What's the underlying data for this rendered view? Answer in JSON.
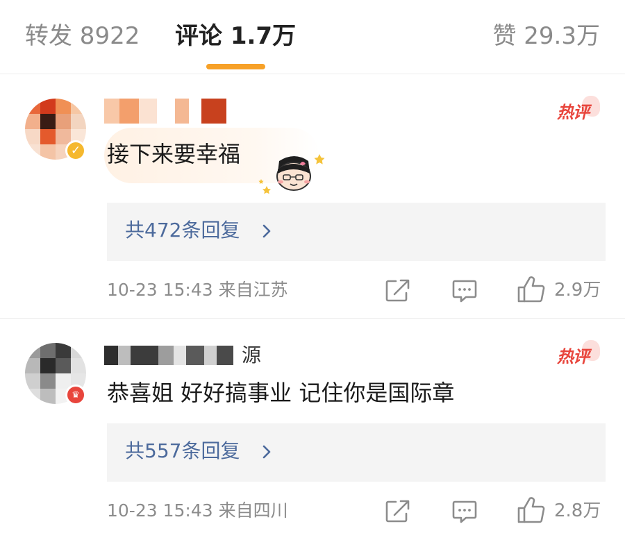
{
  "tabs": {
    "forward": "转发 8922",
    "comments": "评论 1.7万",
    "likes": "赞 29.3万"
  },
  "colors": {
    "accent": "#f7a128",
    "link": "#4c6a9c",
    "hot": "#e8453c",
    "muted": "#8c8c8c"
  },
  "comments": [
    {
      "text": "接下来要幸福",
      "hot_label": "热评",
      "replies_label": "共472条回复",
      "meta": "10-23 15:43 来自江苏",
      "likes": "2.9万",
      "badge": "verified-v-badge"
    },
    {
      "username_partial": "源",
      "text": "恭喜姐 好好搞事业 记住你是国际章",
      "hot_label": "热评",
      "replies_label": "共557条回复",
      "meta": "10-23 15:43 来自四川",
      "likes": "2.8万",
      "badge": "red-member-badge"
    }
  ],
  "icons": [
    "share-icon",
    "comment-icon",
    "like-icon",
    "chevron-right-icon"
  ]
}
